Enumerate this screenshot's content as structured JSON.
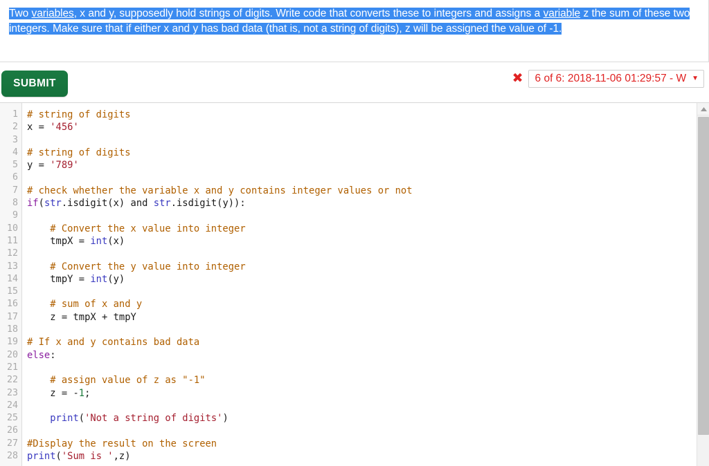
{
  "question": {
    "selected": true,
    "segments": [
      {
        "text": "Two ",
        "link": false
      },
      {
        "text": "variables",
        "link": true
      },
      {
        "text": ", x and y, supposedly hold strings of digits. Write code that converts these to integers and assigns a ",
        "link": false
      },
      {
        "text": "variable",
        "link": true
      },
      {
        "text": " z the sum of these two integers. Make sure that if either x and y has bad data (that is, not a string of digits), z will be assigned the value of -1.",
        "link": false
      }
    ],
    "plain_text": "Two variables, x and y, supposedly hold strings of digits. Write code that converts these to integers and assigns a variable z the sum of these two integers. Make sure that if either x and y has bad data (that is, not a string of digits), z will be assigned the value of -1."
  },
  "toolbar": {
    "submit_label": "SUBMIT",
    "status_icon": "cross-mark-icon",
    "status_icon_glyph": "✖",
    "attempt_label": "6 of 6: 2018-11-06 01:29:57 - W",
    "attempt_caret": "▼",
    "status_color": "#e02222",
    "submit_color": "#157240"
  },
  "editor": {
    "selection_color": "#3b8bf0",
    "line_numbers": [
      1,
      2,
      3,
      4,
      5,
      6,
      7,
      8,
      9,
      10,
      11,
      12,
      13,
      14,
      15,
      16,
      17,
      18,
      19,
      20,
      21,
      22,
      23,
      24,
      25,
      26,
      27,
      28
    ],
    "lines": [
      {
        "n": 1,
        "tokens": [
          {
            "t": "# string of digits",
            "c": "comment"
          }
        ]
      },
      {
        "n": 2,
        "tokens": [
          {
            "t": "x = ",
            "c": "plain"
          },
          {
            "t": "'456'",
            "c": "string"
          }
        ]
      },
      {
        "n": 3,
        "tokens": []
      },
      {
        "n": 4,
        "tokens": [
          {
            "t": "# string of digits",
            "c": "comment"
          }
        ]
      },
      {
        "n": 5,
        "tokens": [
          {
            "t": "y = ",
            "c": "plain"
          },
          {
            "t": "'789'",
            "c": "string"
          }
        ]
      },
      {
        "n": 6,
        "tokens": []
      },
      {
        "n": 7,
        "tokens": [
          {
            "t": "# check whether the variable x and y contains integer values or not",
            "c": "comment"
          }
        ]
      },
      {
        "n": 8,
        "tokens": [
          {
            "t": "if",
            "c": "keyword"
          },
          {
            "t": "(",
            "c": "plain"
          },
          {
            "t": "str",
            "c": "builtin"
          },
          {
            "t": ".isdigit(x) and ",
            "c": "plain"
          },
          {
            "t": "str",
            "c": "builtin"
          },
          {
            "t": ".isdigit(y)):",
            "c": "plain"
          }
        ]
      },
      {
        "n": 9,
        "tokens": []
      },
      {
        "n": 10,
        "tokens": [
          {
            "t": "    # Convert the x value into integer",
            "c": "comment"
          }
        ]
      },
      {
        "n": 11,
        "tokens": [
          {
            "t": "    tmpX = ",
            "c": "plain"
          },
          {
            "t": "int",
            "c": "builtin"
          },
          {
            "t": "(x)",
            "c": "plain"
          }
        ]
      },
      {
        "n": 12,
        "tokens": []
      },
      {
        "n": 13,
        "tokens": [
          {
            "t": "    # Convert the y value into integer",
            "c": "comment"
          }
        ]
      },
      {
        "n": 14,
        "tokens": [
          {
            "t": "    tmpY = ",
            "c": "plain"
          },
          {
            "t": "int",
            "c": "builtin"
          },
          {
            "t": "(y)",
            "c": "plain"
          }
        ]
      },
      {
        "n": 15,
        "tokens": []
      },
      {
        "n": 16,
        "tokens": [
          {
            "t": "    # sum of x and y",
            "c": "comment"
          }
        ]
      },
      {
        "n": 17,
        "tokens": [
          {
            "t": "    z = tmpX + tmpY",
            "c": "plain"
          }
        ]
      },
      {
        "n": 18,
        "tokens": []
      },
      {
        "n": 19,
        "tokens": [
          {
            "t": "# If x and y contains bad data",
            "c": "comment"
          }
        ]
      },
      {
        "n": 20,
        "tokens": [
          {
            "t": "else",
            "c": "keyword"
          },
          {
            "t": ":",
            "c": "plain"
          }
        ]
      },
      {
        "n": 21,
        "tokens": []
      },
      {
        "n": 22,
        "tokens": [
          {
            "t": "    # assign value of z as \"-1\"",
            "c": "comment"
          }
        ]
      },
      {
        "n": 23,
        "tokens": [
          {
            "t": "    z = -",
            "c": "plain"
          },
          {
            "t": "1",
            "c": "number"
          },
          {
            "t": ";",
            "c": "plain"
          }
        ]
      },
      {
        "n": 24,
        "tokens": []
      },
      {
        "n": 25,
        "tokens": [
          {
            "t": "    ",
            "c": "plain"
          },
          {
            "t": "print",
            "c": "builtin"
          },
          {
            "t": "(",
            "c": "plain"
          },
          {
            "t": "'Not a string of digits'",
            "c": "string"
          },
          {
            "t": ")",
            "c": "plain"
          }
        ]
      },
      {
        "n": 26,
        "tokens": []
      },
      {
        "n": 27,
        "tokens": [
          {
            "t": "#Display the result on the screen",
            "c": "comment"
          }
        ]
      },
      {
        "n": 28,
        "tokens": [
          {
            "t": "print",
            "c": "builtin"
          },
          {
            "t": "(",
            "c": "plain"
          },
          {
            "t": "'Sum is '",
            "c": "string"
          },
          {
            "t": ",z)",
            "c": "plain"
          }
        ]
      }
    ]
  }
}
